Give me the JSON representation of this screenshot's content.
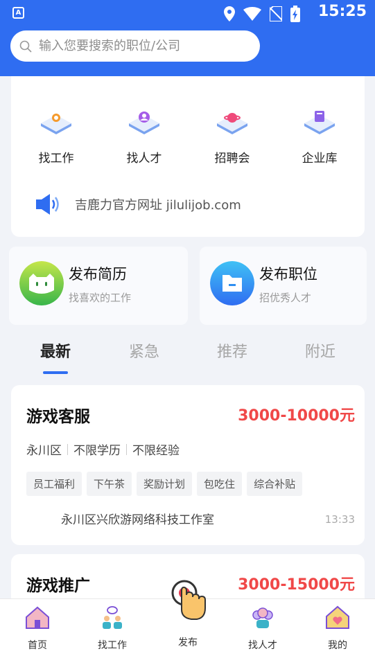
{
  "status_bar": {
    "time": "15:25",
    "app_badge": "A"
  },
  "search": {
    "placeholder": "输入您要搜索的职位/公司"
  },
  "menu": [
    {
      "label": "找工作",
      "icon": "job-search-icon"
    },
    {
      "label": "找人才",
      "icon": "talent-icon"
    },
    {
      "label": "招聘会",
      "icon": "job-fair-icon"
    },
    {
      "label": "企业库",
      "icon": "company-library-icon"
    }
  ],
  "notice": {
    "text": "吉鹿力官方网址 jilulijob.com"
  },
  "publish": {
    "resume": {
      "title": "发布简历",
      "subtitle": "找喜欢的工作"
    },
    "position": {
      "title": "发布职位",
      "subtitle": "招优秀人才"
    }
  },
  "tabs": [
    "最新",
    "紧急",
    "推荐",
    "附近"
  ],
  "active_tab": "最新",
  "jobs": [
    {
      "title": "游戏客服",
      "salary": "3000-10000元",
      "district": "永川区",
      "education": "不限学历",
      "experience": "不限经验",
      "tags": [
        "员工福利",
        "下午茶",
        "奖励计划",
        "包吃住",
        "综合补贴"
      ],
      "company": "永川区兴欣游网络科技工作室",
      "time": "13:33"
    },
    {
      "title": "游戏推广",
      "salary": "3000-15000元"
    }
  ],
  "bottom_nav": [
    {
      "label": "首页",
      "icon": "home-icon"
    },
    {
      "label": "找工作",
      "icon": "find-job-icon"
    },
    {
      "label": "发布",
      "icon": "publish-icon"
    },
    {
      "label": "找人才",
      "icon": "find-talent-icon"
    },
    {
      "label": "我的",
      "icon": "profile-icon"
    }
  ],
  "colors": {
    "primary": "#2f6df1",
    "salary": "#f04848"
  }
}
